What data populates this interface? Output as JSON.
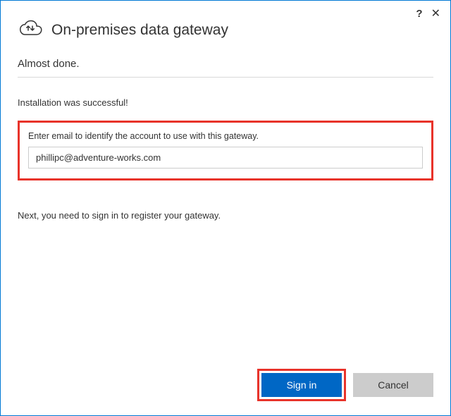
{
  "header": {
    "title": "On-premises data gateway",
    "subtitle": "Almost done."
  },
  "status": "Installation was successful!",
  "email_section": {
    "label": "Enter email to identify the account to use with this gateway.",
    "value": "phillipc@adventure-works.com"
  },
  "next_step": "Next, you need to sign in to register your gateway.",
  "buttons": {
    "signin": "Sign in",
    "cancel": "Cancel"
  },
  "titlebar": {
    "help": "?",
    "close": "✕"
  }
}
